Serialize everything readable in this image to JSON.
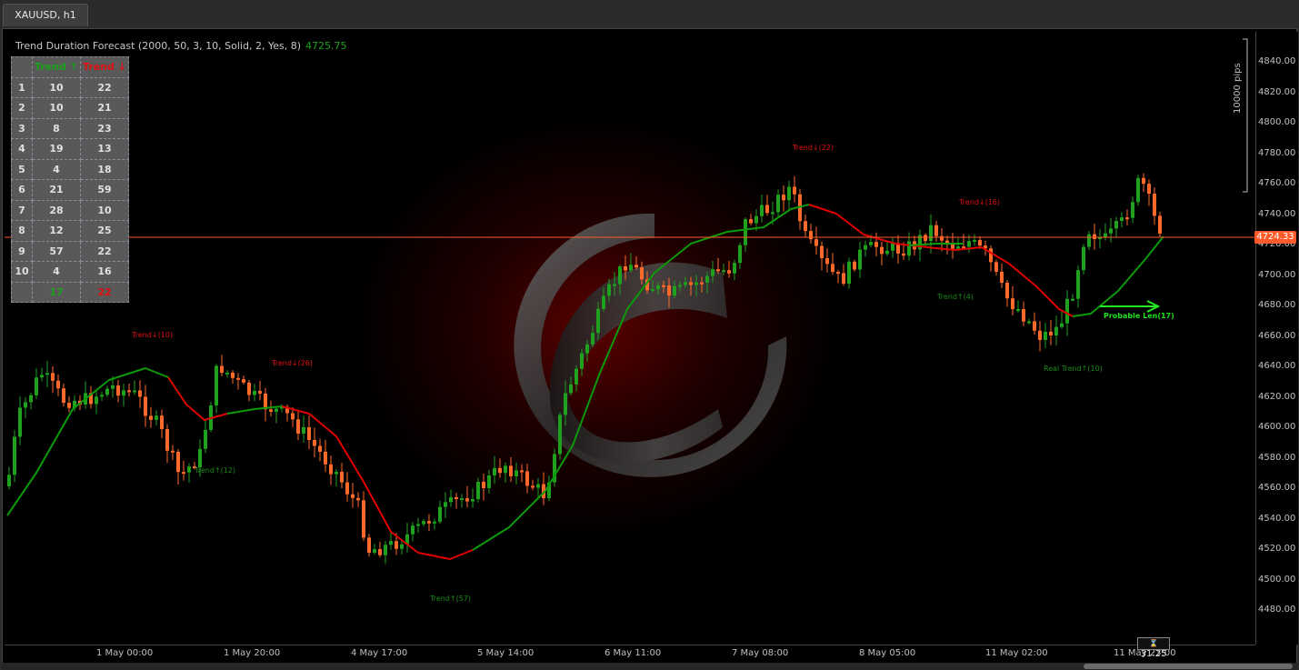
{
  "tab": {
    "title": "XAUUSD, h1"
  },
  "indicator": {
    "title": "Trend Duration Forecast (2000, 50, 3, 10, Solid, 2, Yes, 8)",
    "value": "4725.75"
  },
  "stats_table": {
    "headers": [
      "Trend ↑",
      "Trend ↓"
    ],
    "rows": [
      [
        "1",
        "10",
        "22"
      ],
      [
        "2",
        "10",
        "21"
      ],
      [
        "3",
        "8",
        "23"
      ],
      [
        "4",
        "19",
        "13"
      ],
      [
        "5",
        "4",
        "18"
      ],
      [
        "6",
        "21",
        "59"
      ],
      [
        "7",
        "28",
        "10"
      ],
      [
        "8",
        "12",
        "25"
      ],
      [
        "9",
        "57",
        "22"
      ],
      [
        "10",
        "4",
        "16"
      ]
    ],
    "totals": [
      "",
      "17",
      "22"
    ]
  },
  "price_axis": {
    "labels": [
      "4840.00",
      "4820.00",
      "4800.00",
      "4780.00",
      "4760.00",
      "4740.00",
      "4720.00",
      "4700.00",
      "4680.00",
      "4660.00",
      "4640.00",
      "4620.00",
      "4600.00",
      "4580.00",
      "4560.00",
      "4540.00",
      "4520.00",
      "4500.00",
      "4480.00"
    ],
    "current_price": "4724.33",
    "pips_label": "10000 pips"
  },
  "time_axis": {
    "labels": [
      "1 May 00:00",
      "1 May 20:00",
      "4 May 17:00",
      "5 May 14:00",
      "6 May 11:00",
      "7 May 08:00",
      "8 May 05:00",
      "11 May 02:00",
      "11 May 23:00"
    ],
    "clock": "31:25"
  },
  "annotations": [
    {
      "text": "Trend↓(10)",
      "color": "red"
    },
    {
      "text": "Trend↓(26)",
      "color": "red"
    },
    {
      "text": "Trend↑(12)",
      "color": "green"
    },
    {
      "text": "Trend↑(57)",
      "color": "green"
    },
    {
      "text": "Trend↓(22)",
      "color": "red"
    },
    {
      "text": "Trend↓(16)",
      "color": "red"
    },
    {
      "text": "Trend↑(4)",
      "color": "green"
    },
    {
      "text": "Real Trend↑(10)",
      "color": "green"
    },
    {
      "text": "Probable Len(17)",
      "color": "bright-green"
    }
  ],
  "colors": {
    "bull_candle": "#1fa01f",
    "bear_candle": "#ff6a2a",
    "trend_up_line": "#0a9a0a",
    "trend_down_line": "#e00000",
    "price_line": "#ff5a2a",
    "forecast_arrow": "#22ee22"
  },
  "icons": {
    "watermark": "ctrader-logo-icon",
    "clock": "clock-icon"
  }
}
